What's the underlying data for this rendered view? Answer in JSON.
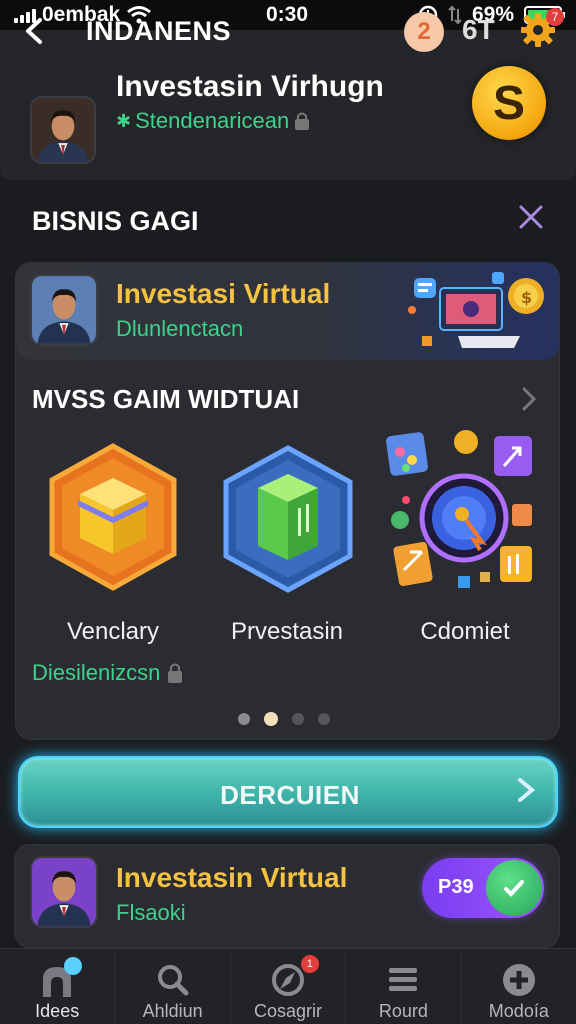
{
  "status_bar": {
    "carrier": "0embak",
    "time": "0:30",
    "battery_percent": "69%",
    "battery_level": 0.69
  },
  "header": {
    "title": "INDANENS",
    "notification_count": "2",
    "score": "6T",
    "settings_badge": "7"
  },
  "profile": {
    "name": "Investasin Virhugn",
    "status": "Stendenaricean"
  },
  "section": {
    "title": "BISNIS GAGI"
  },
  "banner": {
    "title": "Investasi Virtual",
    "subtitle": "Dlunlenctacn"
  },
  "games": {
    "heading": "MVSS GAIM WIDTUAI",
    "items": [
      {
        "label": "Venclary",
        "icon": "yellow-cube-hex-icon"
      },
      {
        "label": "Prvestasin",
        "icon": "green-cube-hex-icon"
      },
      {
        "label": "Cdomiet",
        "icon": "gear-globe-icon"
      }
    ],
    "subtitle": "Diesilenizcsn",
    "pagination": {
      "count": 4,
      "active": 2
    }
  },
  "cta": {
    "label": "DERCUIEN"
  },
  "card": {
    "title": "Investasin Virtual",
    "subtitle": "Flsaoki",
    "toggle_label": "P39",
    "toggle_on": true
  },
  "bottom_nav": [
    {
      "label": "Idees",
      "icon": "home-icon",
      "active": true
    },
    {
      "label": "Ahldiun",
      "icon": "search-icon",
      "active": false
    },
    {
      "label": "Cosagrir",
      "icon": "compass-icon",
      "badge": "1",
      "active": false
    },
    {
      "label": "Rourd",
      "icon": "menu-icon",
      "active": false
    },
    {
      "label": "Modoía",
      "icon": "plus-circle-icon",
      "active": false
    }
  ],
  "colors": {
    "accent_green": "#3cd38b",
    "accent_gold": "#f5c242",
    "cta_glow": "#26b6f0",
    "toggle_purple": "#8a47f7"
  }
}
